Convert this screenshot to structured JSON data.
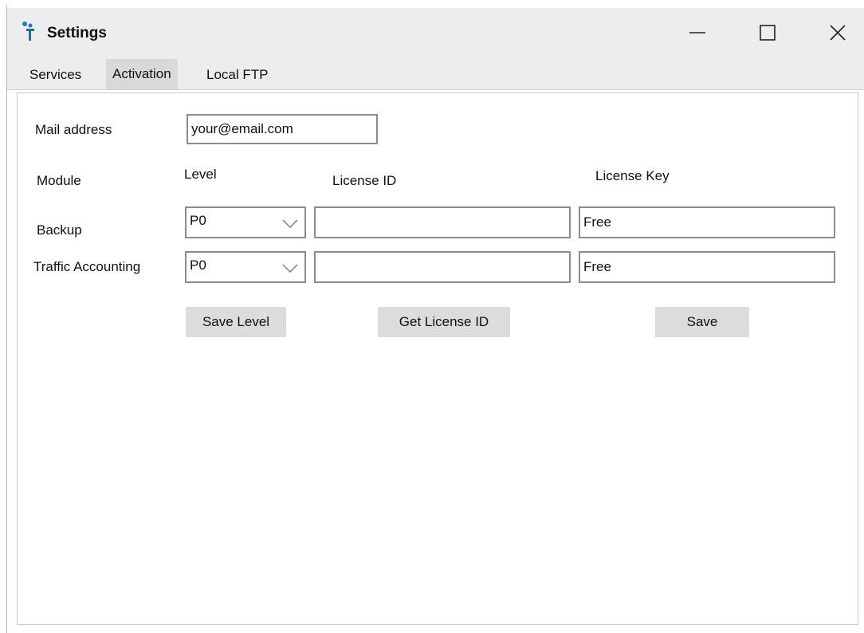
{
  "window": {
    "title": "Settings",
    "controls": {
      "minimize": "minimize-icon",
      "maximize": "maximize-icon",
      "close": "close-icon"
    }
  },
  "tabs": [
    {
      "label": "Services",
      "active": false
    },
    {
      "label": "Activation",
      "active": true
    },
    {
      "label": "Local FTP",
      "active": false
    }
  ],
  "form": {
    "mail_label": "Mail address",
    "mail_value": "your@email.com",
    "headers": {
      "module": "Module",
      "level": "Level",
      "license_id": "License ID",
      "license_key": "License Key"
    },
    "rows": [
      {
        "module": "Backup",
        "level": "P0",
        "license_id": "",
        "license_key": "Free"
      },
      {
        "module": "Traffic Accounting",
        "level": "P0",
        "license_id": "",
        "license_key": "Free"
      }
    ],
    "buttons": {
      "save_level": "Save Level",
      "get_license_id": "Get License ID",
      "save": "Save"
    }
  },
  "colors": {
    "title_bar": "#ededed",
    "button": "#dcdcdc",
    "border": "#8c8c8c",
    "icon_accent": "#1e7bc4"
  }
}
